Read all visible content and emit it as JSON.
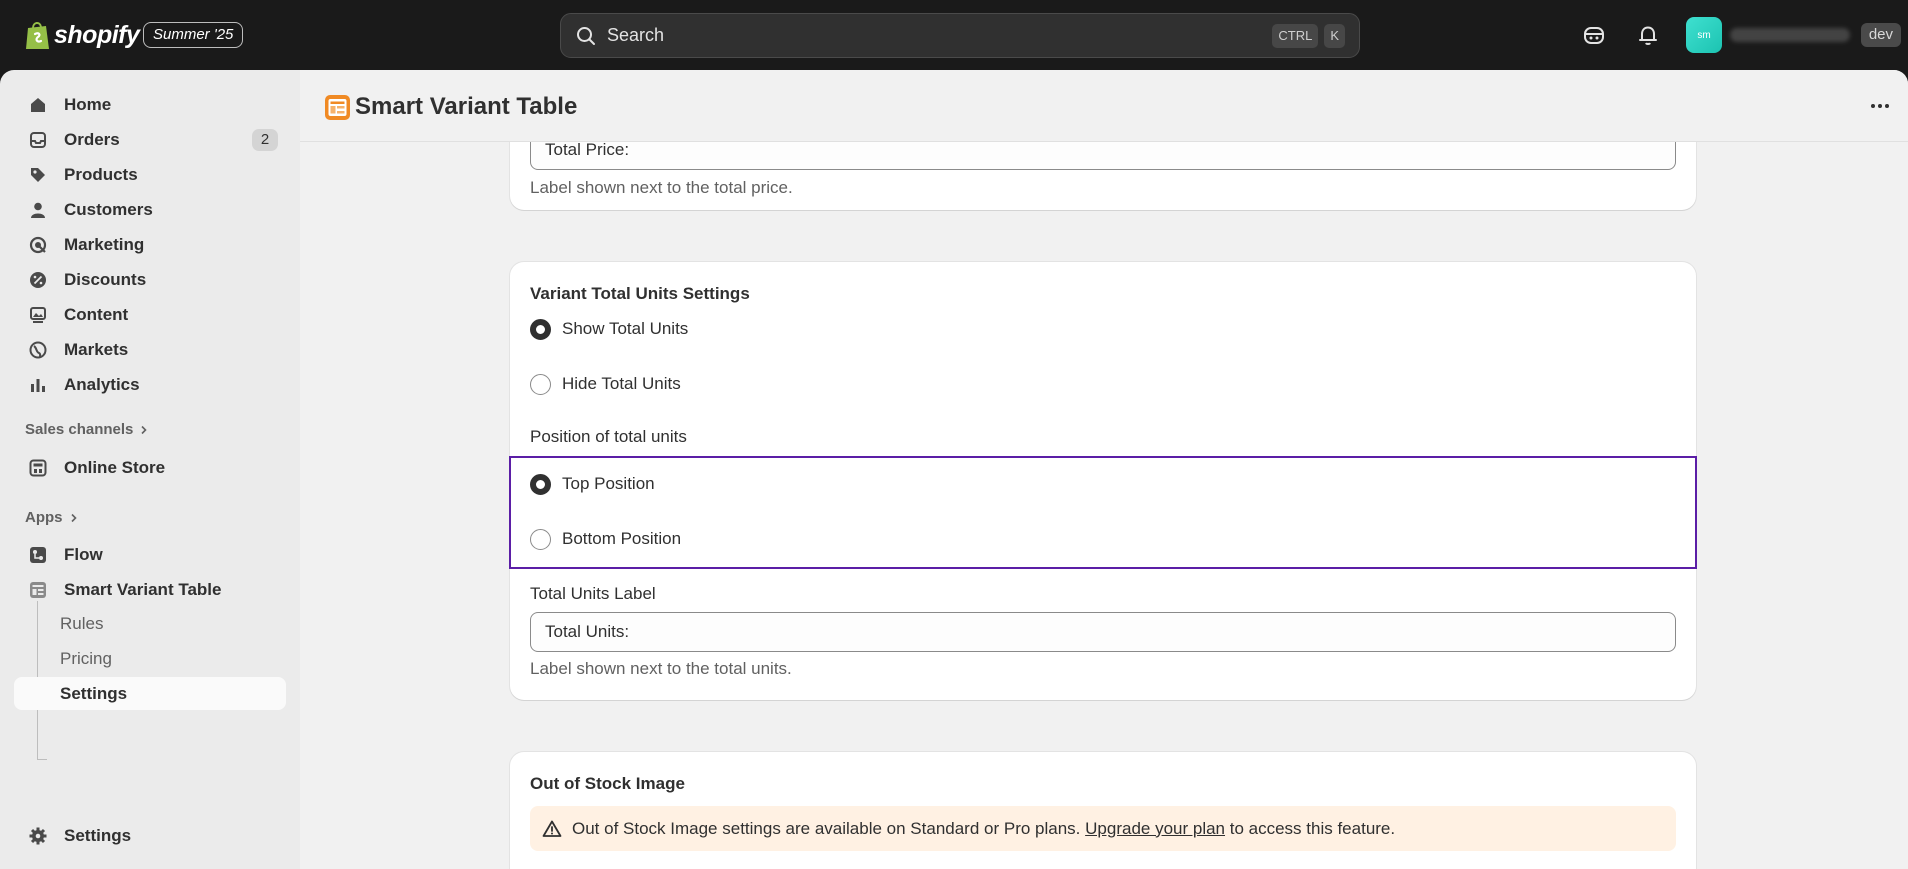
{
  "topbar": {
    "brand": "shopify",
    "edition": "Summer '25",
    "search_placeholder": "Search",
    "shortcut_keys": [
      "CTRL",
      "K"
    ],
    "avatar_initials": "sm",
    "env_badge": "dev"
  },
  "sidebar": {
    "items": [
      {
        "label": "Home",
        "icon": "home-icon"
      },
      {
        "label": "Orders",
        "icon": "orders-icon",
        "count": "2"
      },
      {
        "label": "Products",
        "icon": "tag-icon"
      },
      {
        "label": "Customers",
        "icon": "person-icon"
      },
      {
        "label": "Marketing",
        "icon": "target-icon"
      },
      {
        "label": "Discounts",
        "icon": "discount-icon"
      },
      {
        "label": "Content",
        "icon": "content-icon"
      },
      {
        "label": "Markets",
        "icon": "globe-icon"
      },
      {
        "label": "Analytics",
        "icon": "bar-chart-icon"
      }
    ],
    "sales_channels_label": "Sales channels",
    "online_store_label": "Online Store",
    "apps_label": "Apps",
    "flow_label": "Flow",
    "app_label": "Smart Variant Table",
    "sub_items": [
      "Rules",
      "Pricing",
      "Settings"
    ],
    "active_sub": "Settings",
    "settings_label": "Settings"
  },
  "page": {
    "title": "Smart Variant Table"
  },
  "card_price": {
    "input_value": "Total Price:",
    "help": "Label shown next to the total price."
  },
  "card_units": {
    "title": "Variant Total Units Settings",
    "show_option": "Show Total Units",
    "hide_option": "Hide Total Units",
    "visibility_selected": "Show Total Units",
    "position_label": "Position of total units",
    "top_option": "Top Position",
    "bottom_option": "Bottom Position",
    "position_selected": "Top Position",
    "label_field_label": "Total Units Label",
    "label_field_value": "Total Units:",
    "help": "Label shown next to the total units."
  },
  "card_oos": {
    "title": "Out of Stock Image",
    "banner_text_before": "Out of Stock Image settings are available on Standard or Pro plans.",
    "banner_link": "Upgrade your plan",
    "banner_text_after": "to access this feature."
  },
  "colors": {
    "topbar_bg": "#1a1a1a",
    "focus_outline": "#5b1ea6",
    "banner_bg": "#fff1e3",
    "app_icon": "#f08a24"
  }
}
